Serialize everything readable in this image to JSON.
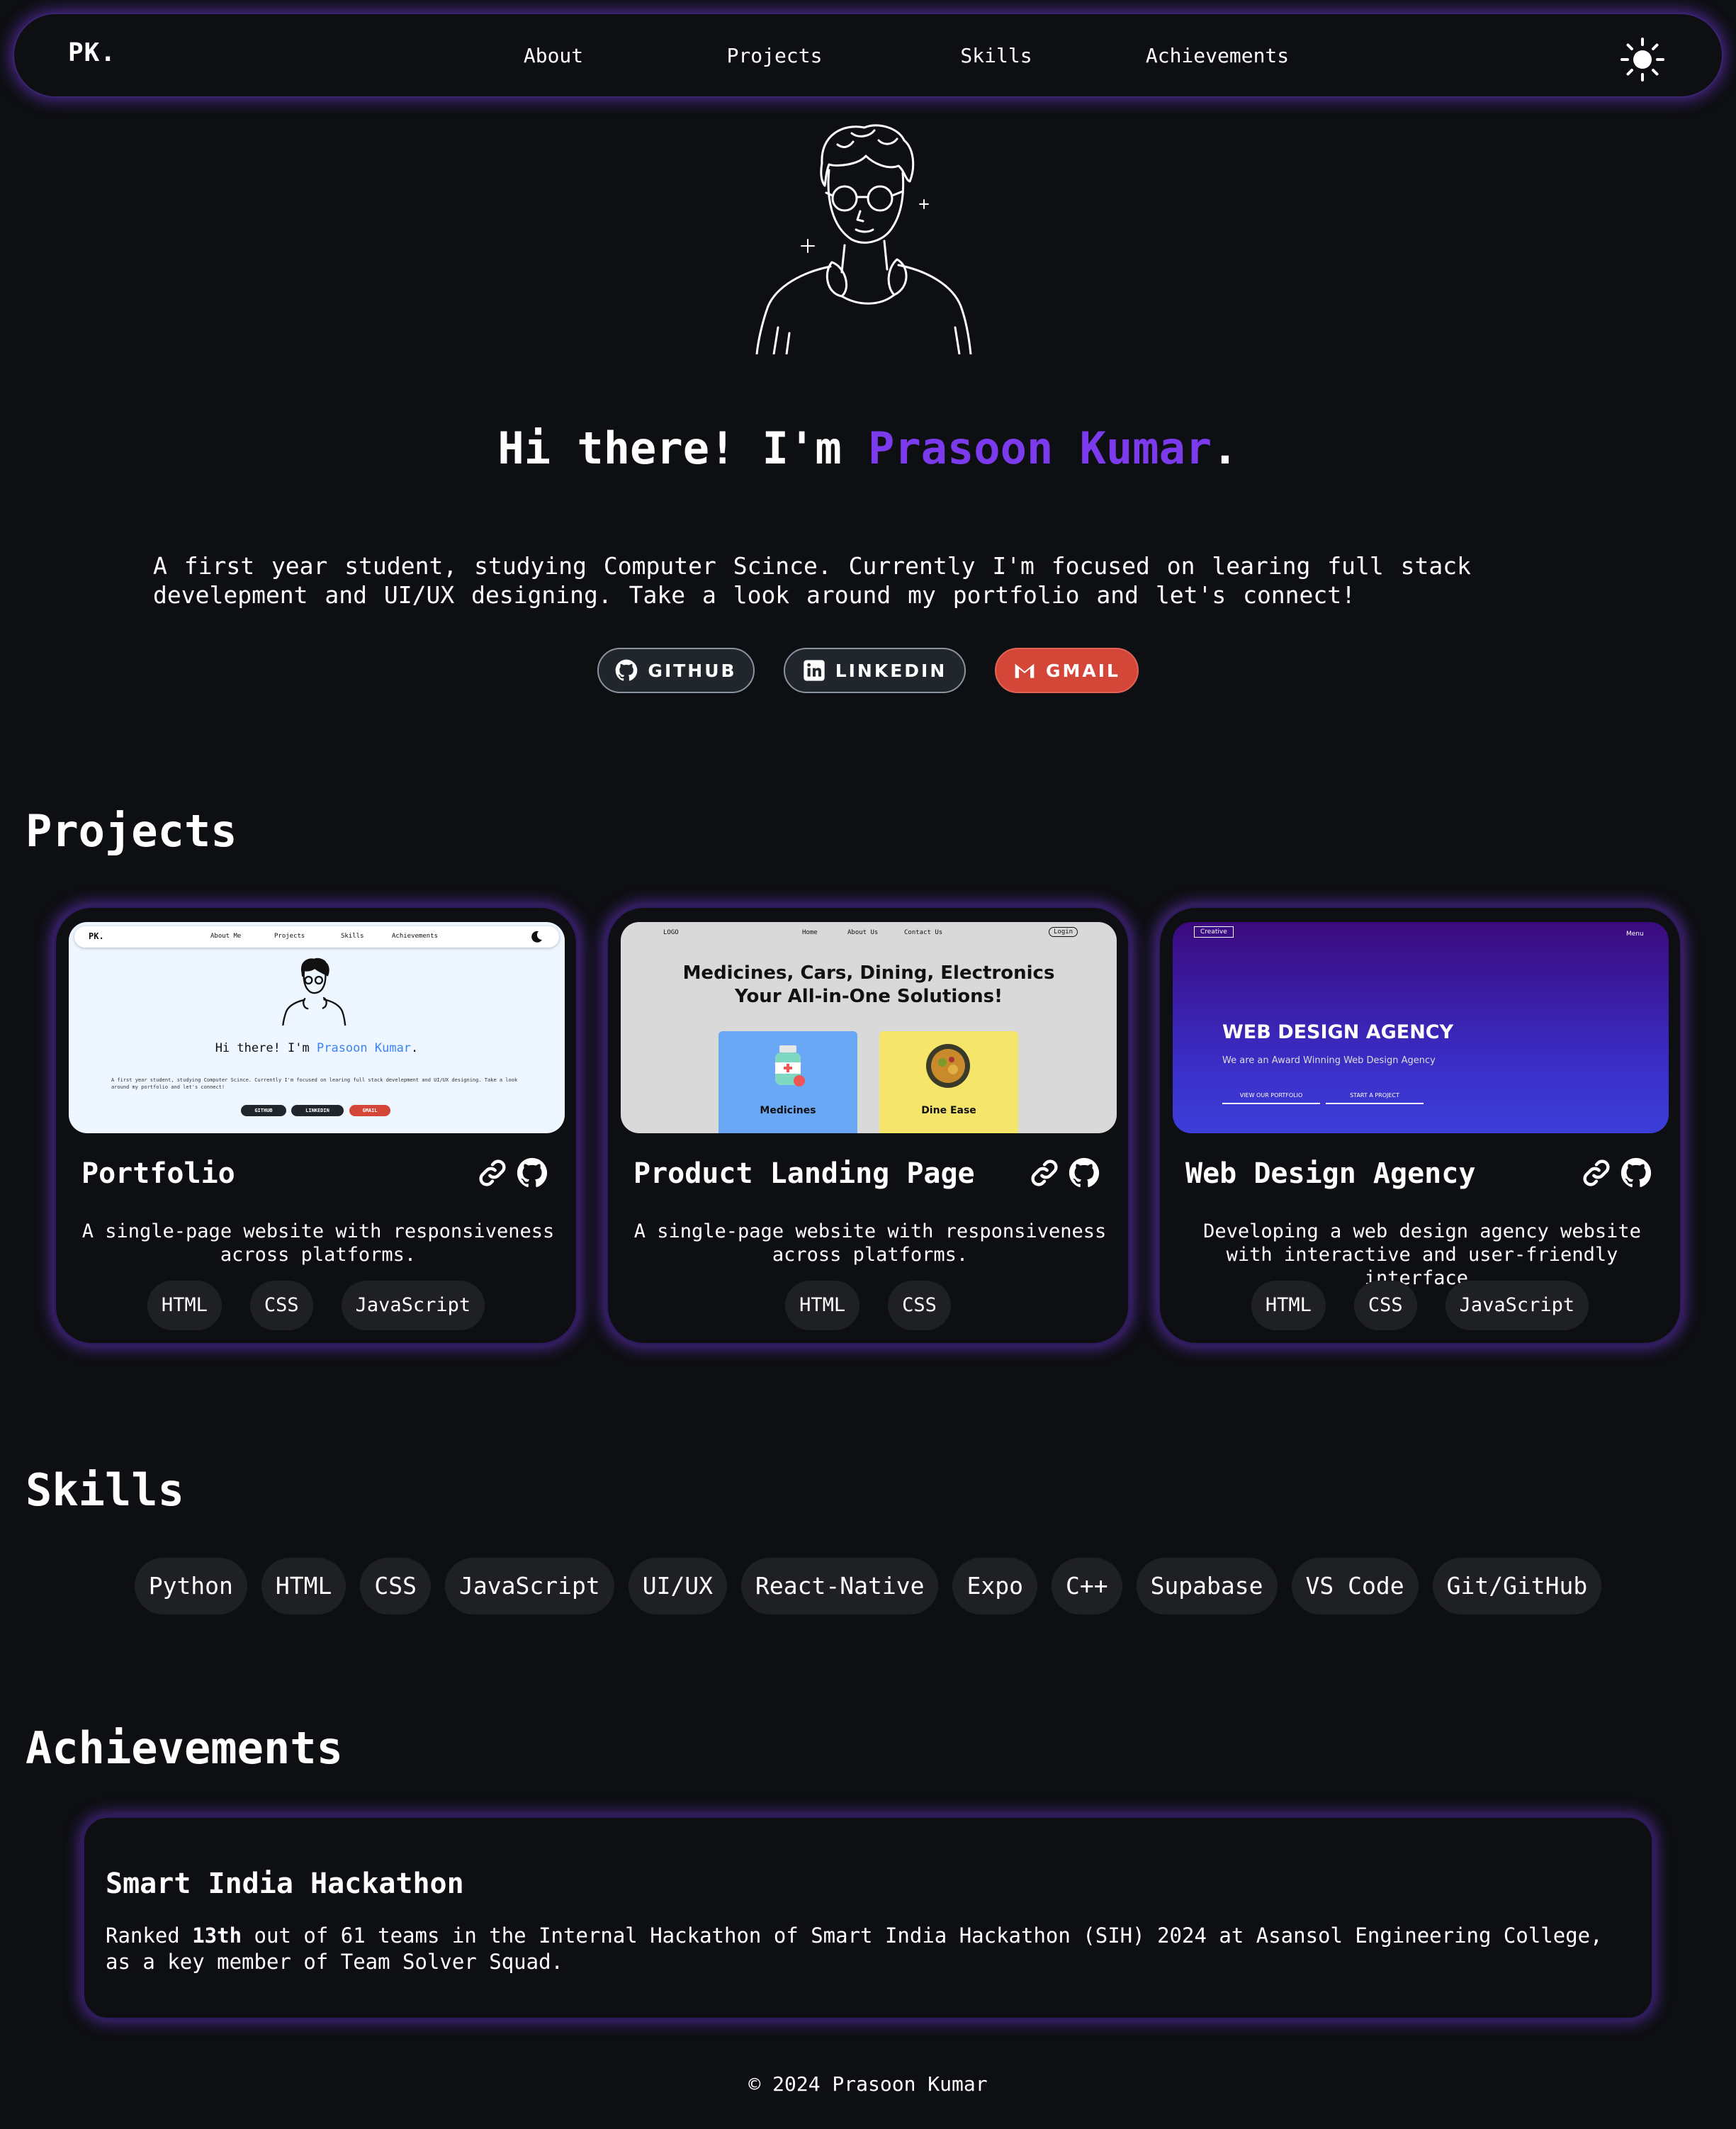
{
  "nav": {
    "logo": "PK.",
    "links": [
      "About",
      "Projects",
      "Skills",
      "Achievements"
    ],
    "theme_icon": "sun-icon"
  },
  "hero": {
    "greeting": "Hi there! I'm ",
    "name": "Prasoon Kumar",
    "period": ".",
    "bio": "A first year student, studying Computer Scince. Currently I'm focused on learing full stack develepment and UI/UX designing. Take a look around my portfolio and let's connect!",
    "buttons": [
      {
        "label": "GITHUB",
        "icon": "github-icon"
      },
      {
        "label": "LINKEDIN",
        "icon": "linkedin-icon"
      },
      {
        "label": "GMAIL",
        "icon": "gmail-icon"
      }
    ],
    "accent_color": "#7c3aed"
  },
  "projects": {
    "heading": "Projects",
    "items": [
      {
        "title": "Portfolio",
        "desc": "A single-page website with responsiveness across platforms.",
        "tags": [
          "HTML",
          "CSS",
          "JavaScript"
        ],
        "preview": {
          "logo": "PK.",
          "nav": [
            "About Me",
            "Projects",
            "Skills",
            "Achievements"
          ],
          "greeting": "Hi there! I'm ",
          "name": "Prasoon Kumar",
          "period": ".",
          "bio": "A first year student, studying Computer Scince. Currently I'm focused on learing full stack develepment and UI/UX designing. Take a look around my portfolio and let's connect!",
          "buttons": [
            "GITHUB",
            "LINKEDIN",
            "GMAIL"
          ]
        }
      },
      {
        "title": "Product Landing Page",
        "desc": "A single-page website with responsiveness across platforms.",
        "tags": [
          "HTML",
          "CSS"
        ],
        "preview": {
          "logo": "LOGO",
          "nav": [
            "Home",
            "About Us",
            "Contact Us"
          ],
          "login": "Login",
          "headline1": "Medicines, Cars, Dining, Electronics",
          "headline2": "Your All-in-One Solutions!",
          "tiles": [
            "Medicines",
            "Dine Ease"
          ]
        }
      },
      {
        "title": "Web Design Agency",
        "desc": "Developing a web design agency website with interactive and user-friendly interface.",
        "tags": [
          "HTML",
          "CSS",
          "JavaScript"
        ],
        "preview": {
          "logo": "Creative",
          "menu": "Menu",
          "headline": "WEB DESIGN AGENCY",
          "sub": "We are an Award Winning Web Design Agency",
          "cta1": "VIEW OUR PORTFOLIO",
          "cta2": "START A PROJECT"
        }
      }
    ]
  },
  "skills": {
    "heading": "Skills",
    "items": [
      "Python",
      "HTML",
      "CSS",
      "JavaScript",
      "UI/UX",
      "React-Native",
      "Expo",
      "C++",
      "Supabase",
      "VS Code",
      "Git/GitHub"
    ]
  },
  "achievements": {
    "heading": "Achievements",
    "items": [
      {
        "title": "Smart India Hackathon",
        "text_before": "Ranked ",
        "rank": "13th",
        "text_after": " out of 61 teams in the Internal Hackathon of Smart India Hackathon (SIH) 2024 at Asansol Engineering College, as a key member of Team Solver Squad."
      }
    ]
  },
  "footer": {
    "text": "© 2024 Prasoon Kumar"
  }
}
